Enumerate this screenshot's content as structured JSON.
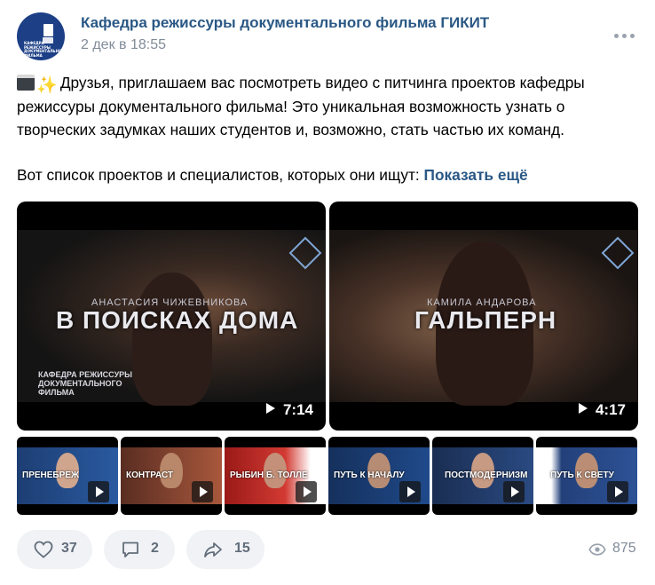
{
  "post": {
    "author": "Кафедра режиссуры документального фильма ГИКИТ",
    "date": "2 дек в 18:55",
    "avatar_text": "КАФЕДРА РЕЖИССУРЫ ДОКУМЕНТАЛЬНОГО ФИЛЬМА",
    "text_line1": "Друзья, приглашаем вас посмотреть видео с питчинга проектов кафедры режиссуры документального фильма! Это уникальная возможность узнать о творческих задумках наших студентов и, возможно, стать частью их команд.",
    "text_line2": "Вот список проектов и специалистов, которых они ищут:",
    "show_more": "Показать ещё",
    "emoji": [
      "clapper-board",
      "sparkles"
    ]
  },
  "videos": [
    {
      "subtitle": "АНАСТАСИЯ ЧИЖЕВНИКОВА",
      "title": "В ПОИСКАХ ДОМА",
      "brand": "КАФЕДРА РЕЖИССУРЫ ДОКУМЕНТАЛЬНОГО ФИЛЬМА",
      "duration": "7:14"
    },
    {
      "subtitle": "КАМИЛА АНДАРОВА",
      "title": "ГАЛЬПЕРН",
      "brand": "",
      "duration": "4:17"
    }
  ],
  "thumbnails": [
    {
      "title": "ПРЕНЕБРЕЖ"
    },
    {
      "title": "КОНТРАСТ"
    },
    {
      "title": "РЫБИН Б. ТОЛЛЕ"
    },
    {
      "title": "ПУТЬ К НАЧАЛУ"
    },
    {
      "title": "ПОСТМОДЕРНИЗМ"
    },
    {
      "title": "ПУТЬ К СВЕТУ"
    }
  ],
  "actions": {
    "likes": "37",
    "comments": "2",
    "shares": "15",
    "views": "875"
  },
  "icons": {
    "like": "heart-icon",
    "comment": "comment-icon",
    "share": "share-icon",
    "views": "eye-icon",
    "more": "more-icon",
    "play": "play-icon"
  },
  "colors": {
    "link": "#2a5885",
    "secondary": "#818c99",
    "button_bg": "#f0f2f5"
  }
}
